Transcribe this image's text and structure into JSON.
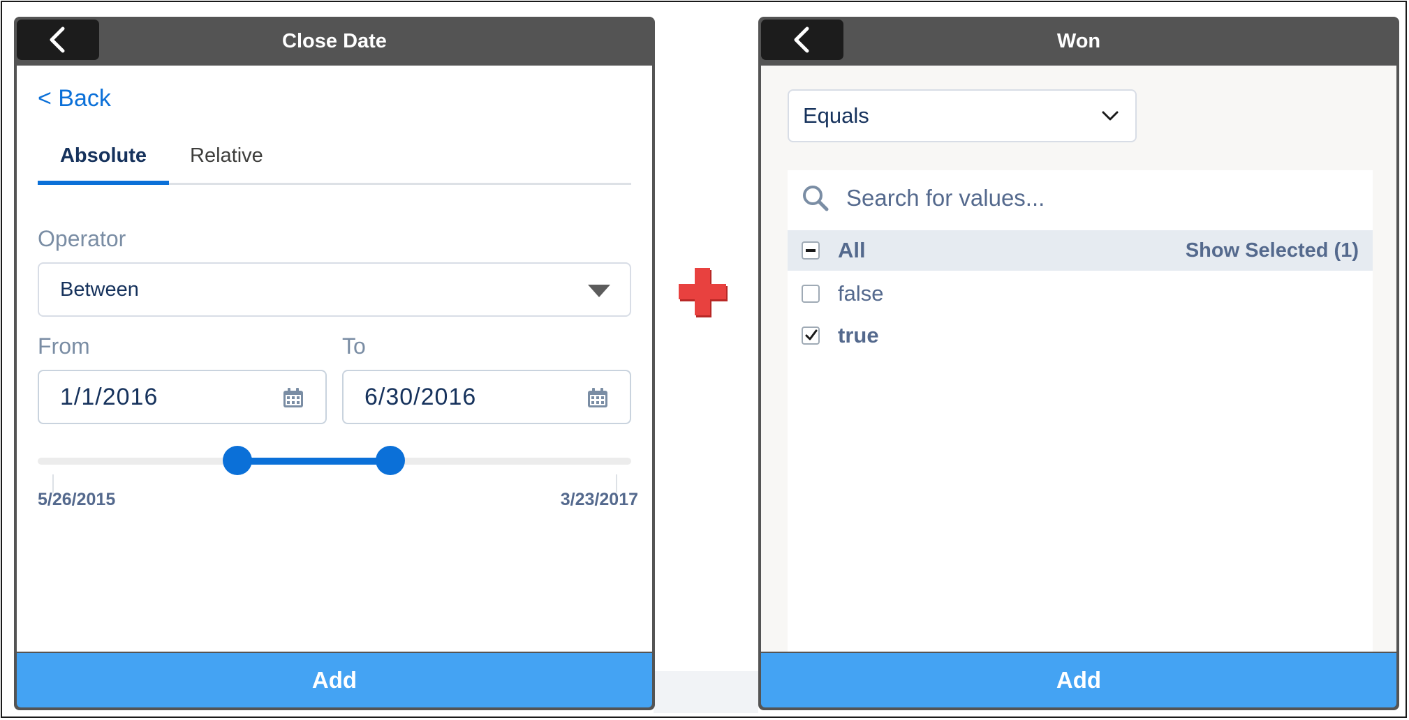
{
  "left_panel": {
    "title": "Close Date",
    "back_link": "< Back",
    "tabs": [
      {
        "label": "Absolute",
        "active": true
      },
      {
        "label": "Relative",
        "active": false
      }
    ],
    "operator_label": "Operator",
    "operator_value": "Between",
    "from_label": "From",
    "from_value": "1/1/2016",
    "to_label": "To",
    "to_value": "6/30/2016",
    "range_min": "5/26/2015",
    "range_max": "3/23/2017",
    "slider": {
      "low_fraction": 0.336,
      "high_fraction": 0.594
    },
    "add_label": "Add"
  },
  "right_panel": {
    "title": "Won",
    "operator_value": "Equals",
    "search_placeholder": "Search for values...",
    "all_label": "All",
    "show_selected": "Show Selected (1)",
    "values": [
      {
        "label": "false",
        "checked": false
      },
      {
        "label": "true",
        "checked": true
      }
    ],
    "add_label": "Add"
  },
  "colors": {
    "header": "#545454",
    "accent": "#0b70d8",
    "add_button": "#44a3f3",
    "plus": "#e8413f"
  }
}
